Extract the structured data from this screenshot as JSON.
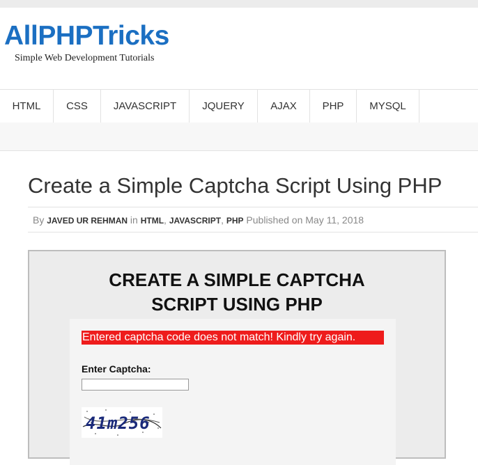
{
  "site": {
    "logo_text": "AllPHPTricks",
    "tagline": "Simple Web Development Tutorials"
  },
  "nav": {
    "items": [
      {
        "label": "HTML"
      },
      {
        "label": "CSS"
      },
      {
        "label": "JAVASCRIPT"
      },
      {
        "label": "JQUERY"
      },
      {
        "label": "AJAX"
      },
      {
        "label": "PHP"
      },
      {
        "label": "MYSQL"
      }
    ]
  },
  "post": {
    "title": "Create a Simple Captcha Script Using PHP",
    "by": "By",
    "author": "JAVED UR REHMAN",
    "in": "in",
    "categories": [
      "HTML",
      "JAVASCRIPT",
      "PHP"
    ],
    "separator": ",",
    "published_label": "Published on",
    "date": "May 11, 2018"
  },
  "figure": {
    "title_line1": "CREATE A SIMPLE CAPTCHA",
    "title_line2": "SCRIPT USING PHP",
    "error": "Entered captcha code does not match! Kindly try again.",
    "captcha_label": "Enter Captcha:",
    "captcha_value": "",
    "captcha_code": "41m256"
  },
  "colors": {
    "brand": "#1b6fc2",
    "error_bg": "#ee1c1c",
    "captcha_text": "#1a2a7a"
  }
}
